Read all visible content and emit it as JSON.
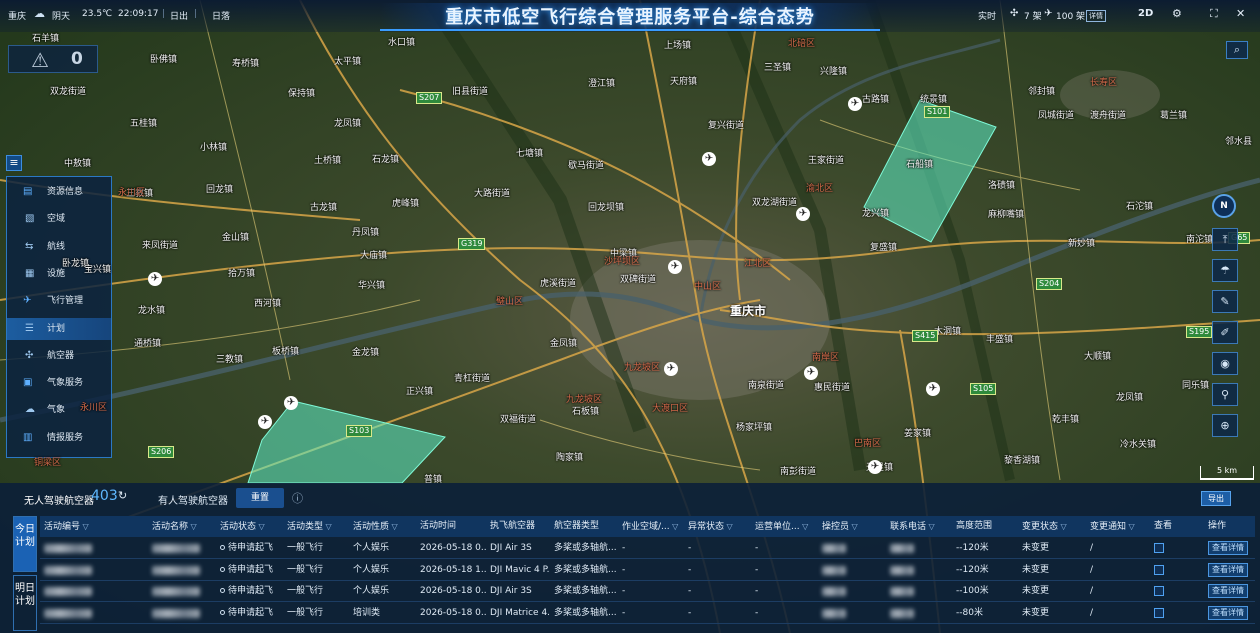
{
  "header": {
    "city": "重庆",
    "weather": "阴天",
    "temperature": "23.5℃",
    "time": "22:09:17",
    "sunrise_label": "日出",
    "sunset_label": "日落",
    "title": "重庆市低空飞行综合管理服务平台-综合态势",
    "realtime_label": "实时",
    "uav_count": "7 架",
    "manned_count": "100 架",
    "detail_label": "详情",
    "view_mode": "2D"
  },
  "alert": {
    "count": "0"
  },
  "sidebar": {
    "items": [
      {
        "label": "资源信息",
        "icon": "layers-icon",
        "group": true
      },
      {
        "label": "空域",
        "icon": "airspace-icon",
        "group": false
      },
      {
        "label": "航线",
        "icon": "route-icon",
        "group": false
      },
      {
        "label": "设施",
        "icon": "facility-icon",
        "group": false
      },
      {
        "label": "飞行管理",
        "icon": "flight-icon",
        "group": true
      },
      {
        "label": "计划",
        "icon": "plan-icon",
        "group": false,
        "active": true
      },
      {
        "label": "航空器",
        "icon": "aircraft-icon",
        "group": false
      },
      {
        "label": "气象服务",
        "icon": "weather-service-icon",
        "group": true
      },
      {
        "label": "气象",
        "icon": "cloud-icon",
        "group": false
      },
      {
        "label": "情报服务",
        "icon": "intel-icon",
        "group": true
      }
    ]
  },
  "map": {
    "places": [
      [
        "石羊镇",
        32,
        31
      ],
      [
        "卧佛镇",
        150,
        52
      ],
      [
        "寿桥镇",
        232,
        56
      ],
      [
        "太平镇",
        334,
        54
      ],
      [
        "水口镇",
        388,
        35
      ],
      [
        "上场镇",
        664,
        38
      ],
      [
        "北碚区",
        788,
        36
      ],
      [
        "三圣镇",
        764,
        60
      ],
      [
        "兴隆镇",
        820,
        64
      ],
      [
        "澄江镇",
        588,
        76
      ],
      [
        "天府镇",
        670,
        74
      ],
      [
        "旧县街道",
        452,
        84
      ],
      [
        "双龙街道",
        50,
        84
      ],
      [
        "五桂镇",
        130,
        116
      ],
      [
        "保持镇",
        288,
        86
      ],
      [
        "龙凤镇",
        334,
        116
      ],
      [
        "古路镇",
        862,
        92
      ],
      [
        "统景镇",
        920,
        92
      ],
      [
        "复兴街道",
        708,
        118
      ],
      [
        "长寿区",
        1090,
        75
      ],
      [
        "邻封镇",
        1028,
        84
      ],
      [
        "凤城街道",
        1038,
        108
      ],
      [
        "渡舟街道",
        1090,
        108
      ],
      [
        "葛兰镇",
        1160,
        108
      ],
      [
        "中敖镇",
        64,
        156
      ],
      [
        "小林镇",
        200,
        140
      ],
      [
        "土桥镇",
        314,
        153
      ],
      [
        "石龙镇",
        372,
        152
      ],
      [
        "七塘镇",
        516,
        146
      ],
      [
        "歇马街道",
        568,
        158
      ],
      [
        "王家街道",
        808,
        153
      ],
      [
        "石船镇",
        906,
        157
      ],
      [
        "邻水县",
        1225,
        134
      ],
      [
        "回龙镇",
        206,
        182
      ],
      [
        "大路街道",
        474,
        186
      ],
      [
        "双龙湖街道",
        752,
        195
      ],
      [
        "渝北区",
        806,
        181
      ],
      [
        "洛碛镇",
        988,
        178
      ],
      [
        "古龙镇",
        310,
        200
      ],
      [
        "虎峰镇",
        392,
        196
      ],
      [
        "回龙坝镇",
        588,
        200
      ],
      [
        "龙兴镇",
        862,
        206
      ],
      [
        "麻柳嘴镇",
        988,
        207
      ],
      [
        "石沱镇",
        1126,
        199
      ],
      [
        "三教镇",
        126,
        186
      ],
      [
        "永川区",
        118,
        185
      ],
      [
        "金山镇",
        222,
        230
      ],
      [
        "丹凤镇",
        352,
        225
      ],
      [
        "中梁镇",
        610,
        246
      ],
      [
        "复盛镇",
        870,
        240
      ],
      [
        "新妙镇",
        1068,
        236
      ],
      [
        "南沱镇",
        1186,
        232
      ],
      [
        "来凤街道",
        142,
        238
      ],
      [
        "卧龙镇",
        62,
        256
      ],
      [
        "大庙镇",
        360,
        248
      ],
      [
        "宝兴镇",
        84,
        262
      ],
      [
        "拾万镇",
        228,
        266
      ],
      [
        "双碑街道",
        620,
        272
      ],
      [
        "重庆市",
        730,
        302
      ],
      [
        "木洞镇",
        934,
        324
      ],
      [
        "华兴镇",
        358,
        278
      ],
      [
        "虎溪街道",
        540,
        276
      ],
      [
        "沙坪坝区",
        604,
        254
      ],
      [
        "西河镇",
        254,
        296
      ],
      [
        "龙水镇",
        138,
        303
      ],
      [
        "璧山区",
        496,
        294
      ],
      [
        "中山区",
        694,
        279
      ],
      [
        "江北区",
        744,
        256
      ],
      [
        "丰盛镇",
        986,
        332
      ],
      [
        "通桥镇",
        134,
        336
      ],
      [
        "三教镇",
        216,
        352
      ],
      [
        "板桥镇",
        272,
        344
      ],
      [
        "金凤镇",
        550,
        336
      ],
      [
        "金龙镇",
        352,
        345
      ],
      [
        "大顺镇",
        1084,
        349
      ],
      [
        "九龙坡区",
        624,
        360
      ],
      [
        "南岸区",
        812,
        350
      ],
      [
        "青杠街道",
        454,
        371
      ],
      [
        "同乐镇",
        1182,
        378
      ],
      [
        "正兴镇",
        406,
        384
      ],
      [
        "南泉街道",
        748,
        378
      ],
      [
        "惠民街道",
        814,
        380
      ],
      [
        "双福街道",
        500,
        412
      ],
      [
        "九龙坡区",
        566,
        392
      ],
      [
        "石板镇",
        572,
        404
      ],
      [
        "龙凤镇",
        1116,
        390
      ],
      [
        "大渡口区",
        652,
        401
      ],
      [
        "乾丰镇",
        1052,
        412
      ],
      [
        "姜家镇",
        904,
        426
      ],
      [
        "杨家坪镇",
        736,
        420
      ],
      [
        "永川区",
        80,
        400
      ],
      [
        "冷水关镇",
        1120,
        437
      ],
      [
        "巴南区",
        854,
        436
      ],
      [
        "铜梁区",
        34,
        455
      ],
      [
        "陶家镇",
        556,
        450
      ],
      [
        "黎香湖镇",
        1004,
        453
      ],
      [
        "天星镇",
        866,
        460
      ],
      [
        "南彭街道",
        780,
        464
      ],
      [
        "普镇",
        424,
        472
      ]
    ],
    "routes": [
      [
        "S207",
        416,
        92
      ],
      [
        "G319",
        458,
        238
      ],
      [
        "S101",
        924,
        106
      ],
      [
        "S204",
        1036,
        278
      ],
      [
        "G65",
        1228,
        232
      ],
      [
        "S195",
        1186,
        326
      ],
      [
        "S105",
        970,
        383
      ],
      [
        "S415",
        912,
        330
      ],
      [
        "S206",
        148,
        446
      ],
      [
        "S103",
        346,
        425
      ]
    ]
  },
  "tools": [
    {
      "icon": "measure-icon"
    },
    {
      "icon": "weather-icon"
    },
    {
      "icon": "draw-icon"
    },
    {
      "icon": "pen-icon"
    },
    {
      "icon": "locate-icon"
    },
    {
      "icon": "pin-icon"
    },
    {
      "icon": "zoom-in-icon"
    }
  ],
  "scale_label": "5 km",
  "panel": {
    "tab_uav": "无人驾驶航空器",
    "uav_count": "403",
    "tab_manned": "有人驾驶航空器",
    "reset": "重置",
    "export": "导出",
    "day_today": "今日计划",
    "day_tomorrow": "明日计划",
    "columns": [
      "活动编号",
      "活动名称",
      "活动状态",
      "活动类型",
      "活动性质",
      "活动时间",
      "执飞航空器",
      "航空器类型",
      "作业空域/...",
      "异常状态",
      "运营单位...",
      "操控员",
      "联系电话",
      "高度范围",
      "变更状态",
      "变更通知",
      "查看",
      "操作"
    ],
    "rows": [
      {
        "status": "待申请起飞",
        "type": "一般飞行",
        "nature": "个人娱乐",
        "time": "2026-05-18 0...",
        "aircraft": "DJI Air 3S",
        "model": "多桨或多轴航...",
        "airspace": "-",
        "abnormal": "-",
        "operator": "-",
        "phone": "",
        "height": "--120米",
        "change": "未变更",
        "notice": "/",
        "action": "查看详情"
      },
      {
        "status": "待申请起飞",
        "type": "一般飞行",
        "nature": "个人娱乐",
        "time": "2026-05-18 1...",
        "aircraft": "DJI Mavic 4 P...",
        "model": "多桨或多轴航...",
        "airspace": "-",
        "abnormal": "-",
        "operator": "-",
        "phone": "",
        "height": "--120米",
        "change": "未变更",
        "notice": "/",
        "action": "查看详情"
      },
      {
        "status": "待申请起飞",
        "type": "一般飞行",
        "nature": "个人娱乐",
        "time": "2026-05-18 0...",
        "aircraft": "DJI Air 3S",
        "model": "多桨或多轴航...",
        "airspace": "-",
        "abnormal": "-",
        "operator": "-",
        "phone": "",
        "height": "--100米",
        "change": "未变更",
        "notice": "/",
        "action": "查看详情"
      },
      {
        "status": "待申请起飞",
        "type": "一般飞行",
        "nature": "培训类",
        "time": "2026-05-18 0...",
        "aircraft": "DJI Matrice 4...",
        "model": "多桨或多轴航...",
        "airspace": "-",
        "abnormal": "-",
        "operator": "-",
        "phone": "",
        "height": "--80米",
        "change": "未变更",
        "notice": "/",
        "action": "查看详情"
      }
    ]
  },
  "colors": {
    "accent": "#3a9cff",
    "panel": "#0b1f38",
    "zone": "#5ff0c8"
  }
}
